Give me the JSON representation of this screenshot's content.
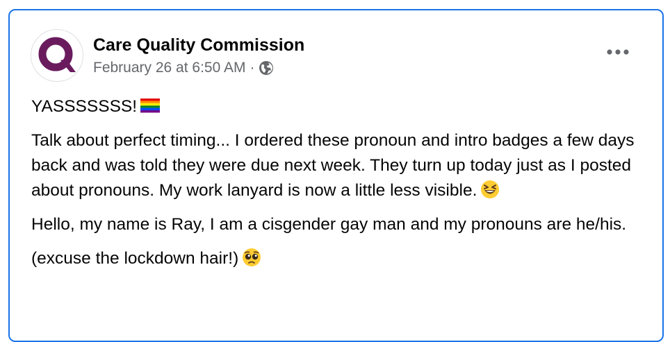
{
  "post": {
    "author": "Care Quality Commission",
    "date": "February 26 at 6:50 AM",
    "separator": "·",
    "privacy_icon": "globe-icon",
    "more_icon": "more-options-icon",
    "avatar_icon": "cqc-logo",
    "paragraphs": {
      "p1": "YASSSSSSS!",
      "p2": "Talk about perfect timing... I ordered these pronoun and intro badges a few days back and was told they were due next week. They turn up today just as I posted about pronouns. My work lanyard is now a little less visible.",
      "p3": "Hello, my name is Ray, I am a cisgender gay man and my pronouns are he/his.",
      "p4": "(excuse the lockdown hair!)"
    },
    "emojis": {
      "p1": "rainbow-flag-emoji",
      "p2": "grinning-squinting-face-emoji",
      "p4": "pleading-face-emoji"
    }
  },
  "colors": {
    "border_accent": "#1a73e8",
    "logo_purple": "#6a1b5e",
    "meta_gray": "#65676b",
    "text": "#050505"
  }
}
